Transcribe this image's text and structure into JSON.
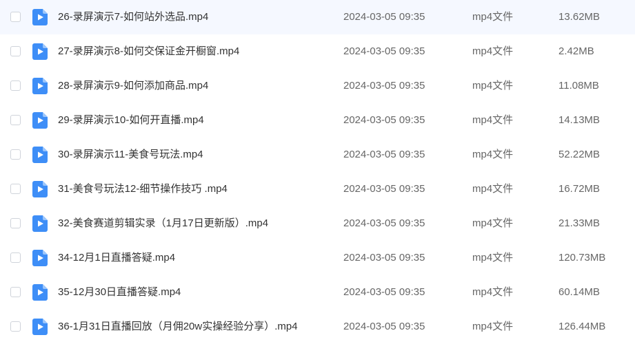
{
  "colors": {
    "icon_body": "#3e8ef7",
    "icon_fold": "#9cc6fb",
    "checkbox_border": "#cfd3da",
    "name_text": "#333333",
    "meta_text": "#666666"
  },
  "file_icon": "video-file-icon",
  "files": [
    {
      "name": "26-录屏演示7-如何站外选品.mp4",
      "time": "2024-03-05 09:35",
      "type": "mp4文件",
      "size": "13.62MB"
    },
    {
      "name": "27-录屏演示8-如何交保证金开橱窗.mp4",
      "time": "2024-03-05 09:35",
      "type": "mp4文件",
      "size": "2.42MB"
    },
    {
      "name": "28-录屏演示9-如何添加商品.mp4",
      "time": "2024-03-05 09:35",
      "type": "mp4文件",
      "size": "11.08MB"
    },
    {
      "name": "29-录屏演示10-如何开直播.mp4",
      "time": "2024-03-05 09:35",
      "type": "mp4文件",
      "size": "14.13MB"
    },
    {
      "name": "30-录屏演示11-美食号玩法.mp4",
      "time": "2024-03-05 09:35",
      "type": "mp4文件",
      "size": "52.22MB"
    },
    {
      "name": "31-美食号玩法12-细节操作技巧 .mp4",
      "time": "2024-03-05 09:35",
      "type": "mp4文件",
      "size": "16.72MB"
    },
    {
      "name": "32-美食赛道剪辑实录（1月17日更新版）.mp4",
      "time": "2024-03-05 09:35",
      "type": "mp4文件",
      "size": "21.33MB"
    },
    {
      "name": "34-12月1日直播答疑.mp4",
      "time": "2024-03-05 09:35",
      "type": "mp4文件",
      "size": "120.73MB"
    },
    {
      "name": "35-12月30日直播答疑.mp4",
      "time": "2024-03-05 09:35",
      "type": "mp4文件",
      "size": "60.14MB"
    },
    {
      "name": "36-1月31日直播回放（月佣20w实操经验分享）.mp4",
      "time": "2024-03-05 09:35",
      "type": "mp4文件",
      "size": "126.44MB"
    }
  ]
}
